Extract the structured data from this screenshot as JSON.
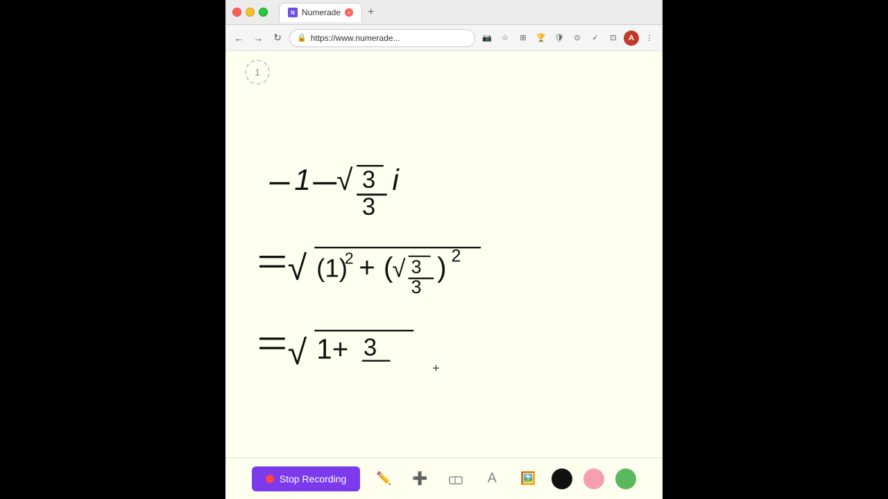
{
  "browser": {
    "title": "Numerade",
    "url": "https://www.numerade...",
    "tab_label": "Numerade",
    "new_tab_label": "+",
    "page_number": "1"
  },
  "nav": {
    "back": "←",
    "forward": "→",
    "refresh": "↻"
  },
  "toolbar_icons": [
    "📹",
    "☆",
    "⊞",
    "🏆",
    "🛡",
    "⊙",
    "✓",
    "⊡",
    "⋮"
  ],
  "avatar_label": "A",
  "bottom_toolbar": {
    "stop_recording_label": "Stop Recording",
    "tools": [
      "pencil",
      "plus",
      "eraser",
      "text",
      "image"
    ],
    "colors": [
      "black",
      "pink",
      "green"
    ]
  }
}
